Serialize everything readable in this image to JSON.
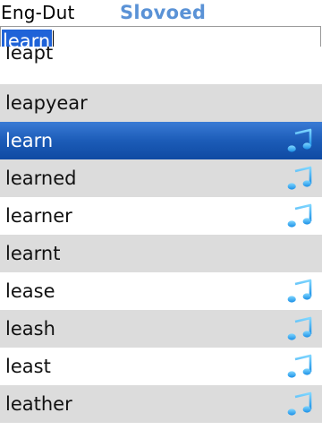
{
  "header": {
    "language_pair": "Eng-Dut",
    "brand": "Slovoed"
  },
  "search": {
    "value": "learn"
  },
  "entries": [
    {
      "word": "leapt",
      "audio": false,
      "selected": false,
      "shade": "white"
    },
    {
      "word": "leapyear",
      "audio": false,
      "selected": false,
      "shade": "gray"
    },
    {
      "word": "learn",
      "audio": true,
      "selected": true,
      "shade": "blue"
    },
    {
      "word": "learned",
      "audio": true,
      "selected": false,
      "shade": "gray"
    },
    {
      "word": "learner",
      "audio": true,
      "selected": false,
      "shade": "white"
    },
    {
      "word": "learnt",
      "audio": false,
      "selected": false,
      "shade": "gray"
    },
    {
      "word": "lease",
      "audio": true,
      "selected": false,
      "shade": "white"
    },
    {
      "word": "leash",
      "audio": true,
      "selected": false,
      "shade": "gray"
    },
    {
      "word": "least",
      "audio": true,
      "selected": false,
      "shade": "white"
    },
    {
      "word": "leather",
      "audio": true,
      "selected": false,
      "shade": "gray"
    }
  ],
  "icons": {
    "audio": "music-note-icon"
  },
  "colors": {
    "brand": "#5a92d6",
    "selection": "#1c5cb8",
    "highlight": "#1f63d8",
    "alt_row": "#dcdcdc"
  }
}
